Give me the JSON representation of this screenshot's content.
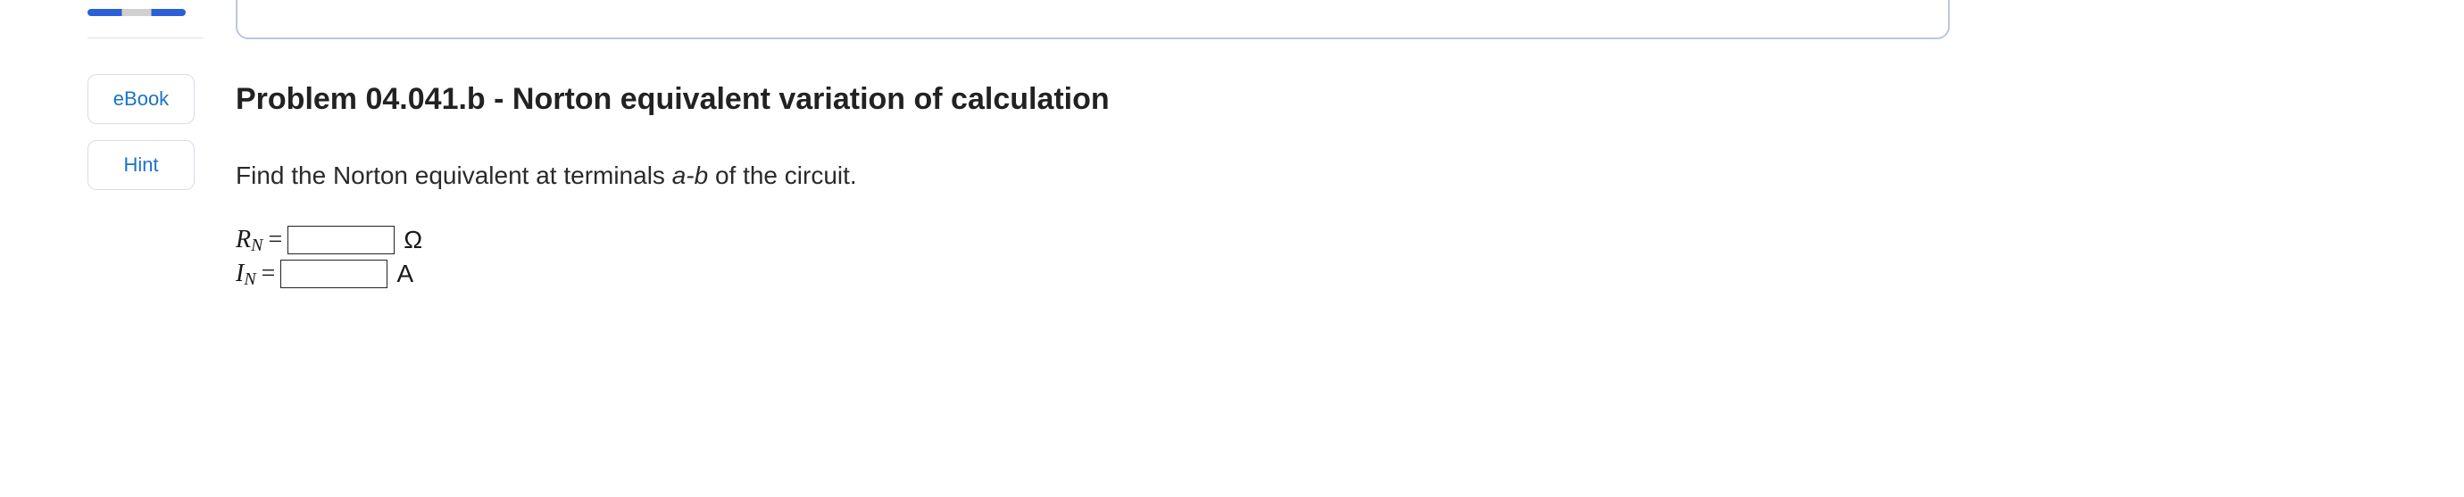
{
  "sidebar": {
    "ebook_label": "eBook",
    "hint_label": "Hint"
  },
  "problem": {
    "title": "Problem 04.041.b - Norton equivalent variation of calculation",
    "instruction_prefix": "Find the Norton equivalent at terminals ",
    "instruction_terminals": "a-b",
    "instruction_suffix": " of the circuit."
  },
  "answers": {
    "rn": {
      "var": "R",
      "sub": "N",
      "eq": "=",
      "value": "",
      "unit": "Ω"
    },
    "in": {
      "var": "I",
      "sub": "N",
      "eq": "=",
      "value": "",
      "unit": "A"
    }
  }
}
